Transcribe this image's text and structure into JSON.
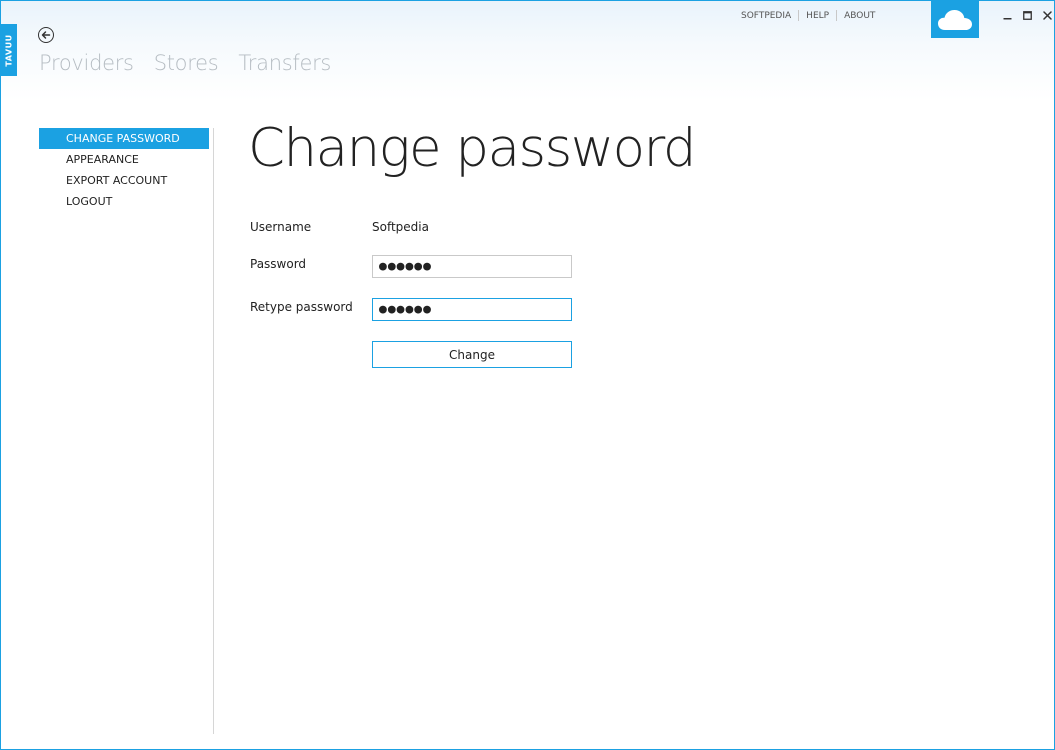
{
  "app": {
    "brand_tab": "TAVUU"
  },
  "header": {
    "nav": [
      {
        "label": "Providers"
      },
      {
        "label": "Stores"
      },
      {
        "label": "Transfers"
      }
    ],
    "links": [
      {
        "label": "SOFTPEDIA"
      },
      {
        "label": "HELP"
      },
      {
        "label": "ABOUT"
      }
    ],
    "cloud_icon": "cloud-icon"
  },
  "window_controls": {
    "minimize": "minimize-icon",
    "maximize": "maximize-icon",
    "close": "close-icon"
  },
  "sidebar": {
    "items": [
      {
        "label": "CHANGE PASSWORD",
        "active": true
      },
      {
        "label": "APPEARANCE",
        "active": false
      },
      {
        "label": "EXPORT ACCOUNT",
        "active": false
      },
      {
        "label": "LOGOUT",
        "active": false
      }
    ]
  },
  "main": {
    "title": "Change password",
    "username_label": "Username",
    "username_value": "Softpedia",
    "password_label": "Password",
    "password_value": "●●●●●●",
    "retype_label": "Retype password",
    "retype_value": "●●●●●●",
    "change_button": "Change"
  },
  "colors": {
    "accent": "#1ba1e2",
    "nav_text": "#b5bcc2"
  }
}
